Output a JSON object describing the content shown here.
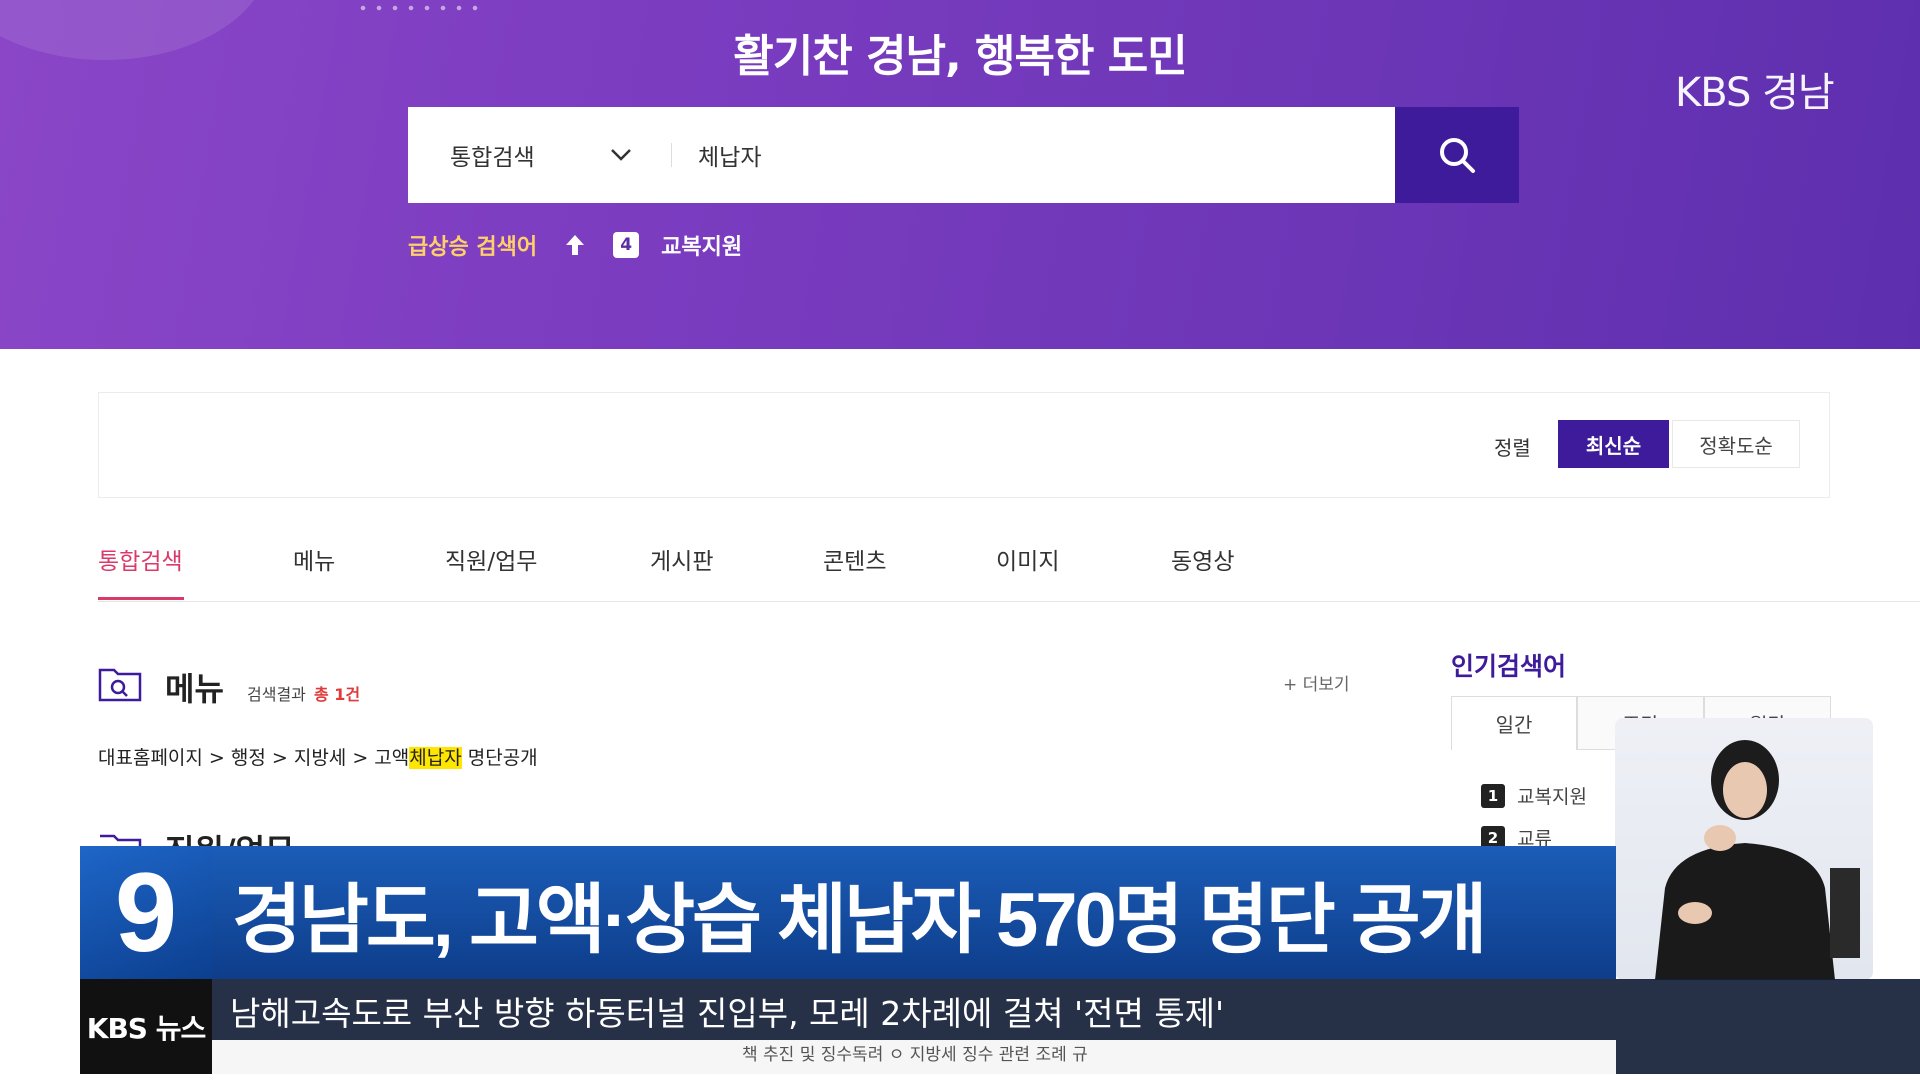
{
  "header": {
    "headline": "활기찬 경남, 행복한 도민",
    "logo": "KBS 경남"
  },
  "search": {
    "category": "통합검색",
    "query": "체납자",
    "button_icon": "search-icon"
  },
  "trending": {
    "label": "급상승 검색어",
    "rank": "4",
    "keyword": "교복지원"
  },
  "sort": {
    "label": "정렬",
    "options": [
      "최신순",
      "정확도순"
    ],
    "selected": "최신순"
  },
  "tabs": [
    "통합검색",
    "메뉴",
    "직원/업무",
    "게시판",
    "콘텐츠",
    "이미지",
    "동영상"
  ],
  "active_tab": "통합검색",
  "menu_section": {
    "title": "메뉴",
    "count_label": "검색결과",
    "count": "총 1건",
    "more": "+ 더보기",
    "path_prefix": "대표홈페이지 > 행정 > 지방세 > 고액",
    "path_highlight": "체납자",
    "path_suffix": " 명단공개"
  },
  "staff_section": {
    "title": "직원/업무"
  },
  "popular": {
    "title": "인기검색어",
    "tabs": [
      "일간",
      "주간",
      "월간"
    ],
    "items": [
      {
        "rank": "1",
        "word": "교복지원"
      },
      {
        "rank": "2",
        "word": "교류"
      }
    ]
  },
  "broadcast": {
    "channel": "9",
    "brand": "KBS 뉴스",
    "headline": "경남도, 고액·상습 체납자 570명 명단 공개",
    "ticker": "남해고속도로 부산 방향 하동터널 진입부, 모레 2차례에 걸쳐 '전면 통제'",
    "under_text": "책 추진 및 징수독려 ㅇ 지방세 징수 관련 조례 규"
  },
  "colors": {
    "banner": "#7b3cc0",
    "accent": "#3e1b9a",
    "tab_active": "#d93a6a",
    "highlight": "#ffe600",
    "news_blue": "#1b5db8"
  }
}
